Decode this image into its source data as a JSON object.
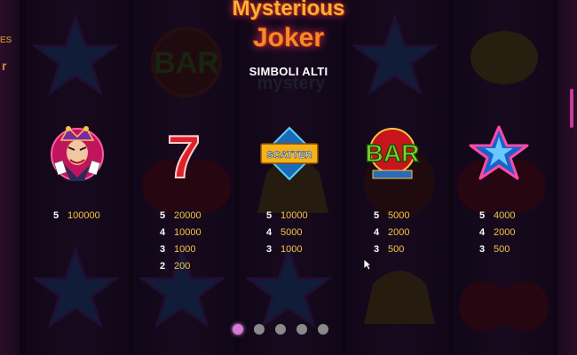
{
  "logo": {
    "line1": "Mysterious",
    "line2": "Joker"
  },
  "section_title": "SIMBOLI ALTI",
  "background": {
    "left_fragment_1": "ES",
    "left_fragment_2": "r"
  },
  "symbols": [
    {
      "name": "joker",
      "icon": "joker-icon",
      "payouts": [
        {
          "count": "5",
          "value": "100000"
        }
      ]
    },
    {
      "name": "seven",
      "icon": "seven-icon",
      "label": "7",
      "payouts": [
        {
          "count": "5",
          "value": "20000"
        },
        {
          "count": "4",
          "value": "10000"
        },
        {
          "count": "3",
          "value": "1000"
        },
        {
          "count": "2",
          "value": "200"
        }
      ]
    },
    {
      "name": "scatter",
      "icon": "scatter-icon",
      "label": "SCATTER",
      "payouts": [
        {
          "count": "5",
          "value": "10000"
        },
        {
          "count": "4",
          "value": "5000"
        },
        {
          "count": "3",
          "value": "1000"
        }
      ]
    },
    {
      "name": "bar",
      "icon": "bar-icon",
      "label": "BAR",
      "payouts": [
        {
          "count": "5",
          "value": "5000"
        },
        {
          "count": "4",
          "value": "2000"
        },
        {
          "count": "3",
          "value": "500"
        }
      ]
    },
    {
      "name": "star",
      "icon": "star-icon",
      "payouts": [
        {
          "count": "5",
          "value": "4000"
        },
        {
          "count": "4",
          "value": "2000"
        },
        {
          "count": "3",
          "value": "500"
        }
      ]
    }
  ],
  "pagination": {
    "total_pages": 5,
    "active_page": 1
  },
  "colors": {
    "accent": "#d878d8",
    "payout_value": "#f5c542",
    "scrollbar": "#c43a9a"
  }
}
